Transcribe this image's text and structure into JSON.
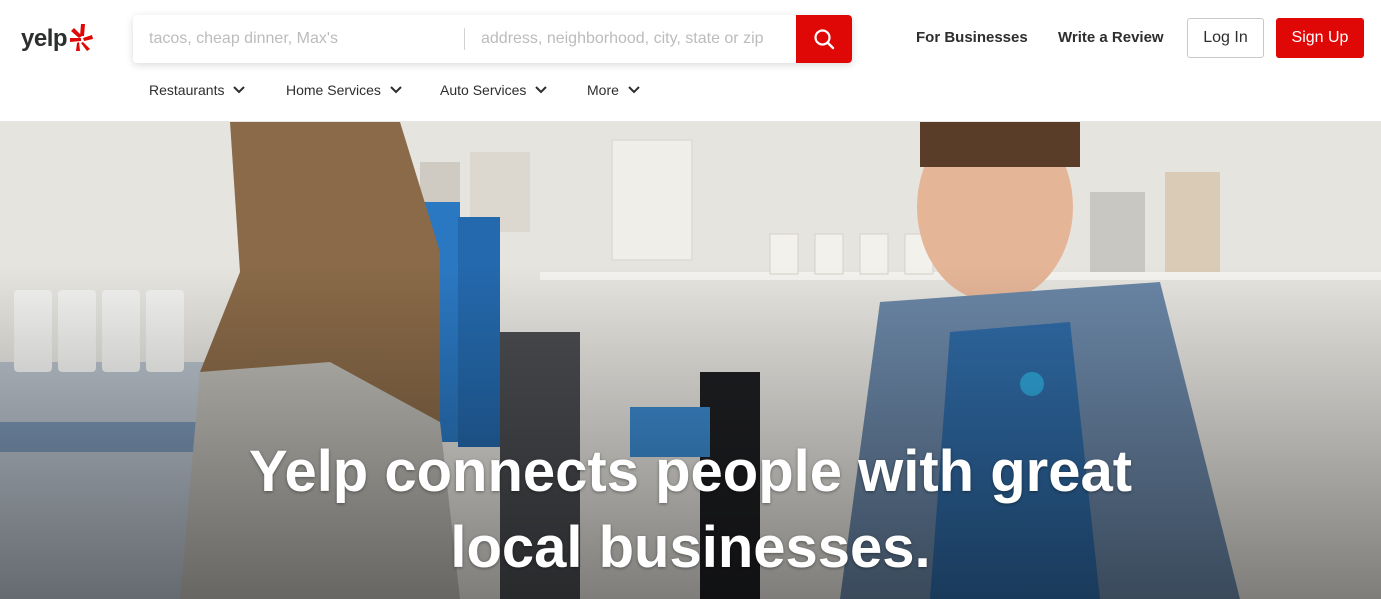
{
  "brand": {
    "name": "yelp",
    "accent": "#e00707"
  },
  "search": {
    "find_placeholder": "tacos, cheap dinner, Max's",
    "near_placeholder": "address, neighborhood, city, state or zip",
    "button_icon": "search-icon"
  },
  "header_links": {
    "for_businesses": "For Businesses",
    "write_review": "Write a Review",
    "log_in": "Log In",
    "sign_up": "Sign Up"
  },
  "categories": [
    {
      "label": "Restaurants",
      "icon": "chevron-down-icon"
    },
    {
      "label": "Home Services",
      "icon": "chevron-down-icon"
    },
    {
      "label": "Auto Services",
      "icon": "chevron-down-icon"
    },
    {
      "label": "More",
      "icon": "chevron-down-icon"
    }
  ],
  "hero": {
    "headline_line1": "Yelp connects people with great",
    "headline_line2": "local businesses."
  }
}
